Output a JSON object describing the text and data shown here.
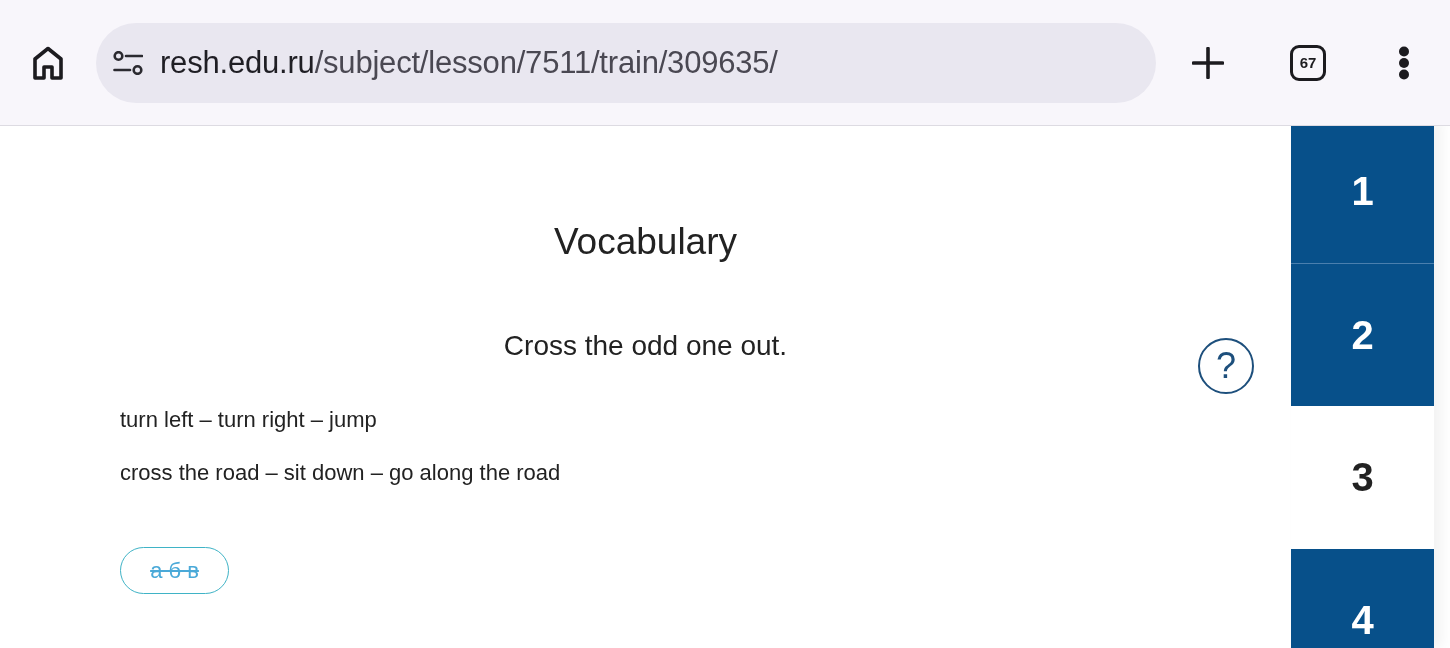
{
  "browser": {
    "url": {
      "host": "resh.edu.ru",
      "path": "/subject/lesson/7511/train/309635/"
    },
    "tab_count": "67"
  },
  "lesson": {
    "title": "Vocabulary",
    "instruction": "Cross the odd one out.",
    "help": "?",
    "lines": [
      "turn left – turn right – jump",
      "cross the road – sit down – go along the road"
    ],
    "strike_button": "а б в"
  },
  "question_nav": [
    {
      "label": "1",
      "selected": false
    },
    {
      "label": "2",
      "selected": false
    },
    {
      "label": "3",
      "selected": true
    },
    {
      "label": "4",
      "selected": false
    }
  ]
}
